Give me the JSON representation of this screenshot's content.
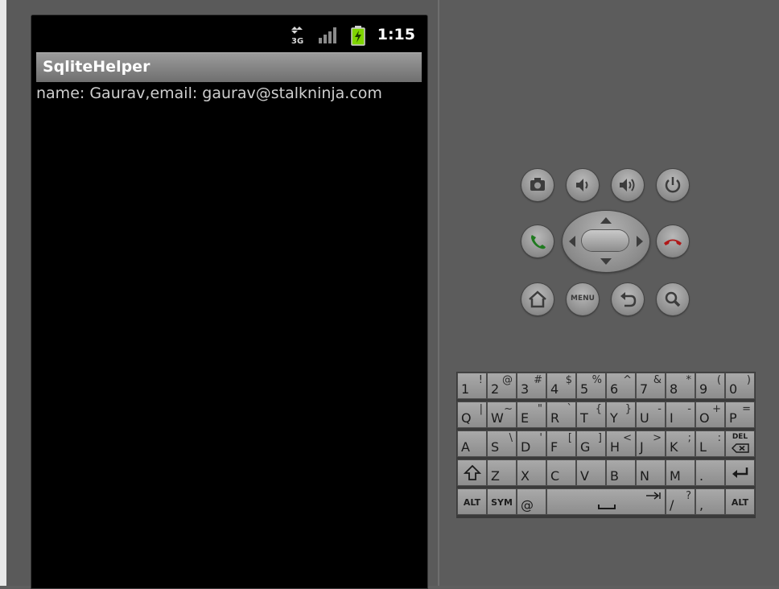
{
  "status_bar": {
    "time": "1:15",
    "network_type": "3G"
  },
  "app": {
    "title": "SqliteHelper",
    "content_text": "name: Gaurav,email: gaurav@stalkninja.com"
  },
  "hardware_buttons": {
    "row1": [
      "camera-icon",
      "volume-down-icon",
      "volume-up-icon",
      "power-icon"
    ],
    "row2": [
      "call-icon",
      "dpad",
      "end-call-icon"
    ],
    "row3": [
      "home-icon",
      "menu-button",
      "back-icon",
      "search-icon"
    ],
    "menu_label": "MENU"
  },
  "keyboard": {
    "row1": [
      {
        "m": "1",
        "a": "!"
      },
      {
        "m": "2",
        "a": "@"
      },
      {
        "m": "3",
        "a": "#"
      },
      {
        "m": "4",
        "a": "$"
      },
      {
        "m": "5",
        "a": "%"
      },
      {
        "m": "6",
        "a": "^"
      },
      {
        "m": "7",
        "a": "&"
      },
      {
        "m": "8",
        "a": "*"
      },
      {
        "m": "9",
        "a": "("
      },
      {
        "m": "0",
        "a": ")"
      }
    ],
    "row2": [
      {
        "m": "Q",
        "a": "|"
      },
      {
        "m": "W",
        "a": "~"
      },
      {
        "m": "E",
        "a": "\""
      },
      {
        "m": "R",
        "a": "`"
      },
      {
        "m": "T",
        "a": "{"
      },
      {
        "m": "Y",
        "a": "}"
      },
      {
        "m": "U",
        "a": "-"
      },
      {
        "m": "I",
        "a": "-"
      },
      {
        "m": "O",
        "a": "+"
      },
      {
        "m": "P",
        "a": "="
      }
    ],
    "row3": [
      {
        "m": "A",
        "a": ""
      },
      {
        "m": "S",
        "a": "\\"
      },
      {
        "m": "D",
        "a": "'"
      },
      {
        "m": "F",
        "a": "["
      },
      {
        "m": "G",
        "a": "]"
      },
      {
        "m": "H",
        "a": "<"
      },
      {
        "m": "J",
        "a": ">"
      },
      {
        "m": "K",
        "a": ";"
      },
      {
        "m": "L",
        "a": ":"
      }
    ],
    "del_label": "DEL",
    "row4": [
      "Z",
      "X",
      "C",
      "V",
      "B",
      "N",
      "M",
      "."
    ],
    "alt_label": "ALT",
    "sym_label": "SYM",
    "at_label": "@",
    "slash_main": "/",
    "slash_alt": "?",
    "comma_label": ","
  },
  "colors": {
    "call_green": "#1f7a1f",
    "end_red": "#b01818",
    "battery_green": "#7fd400"
  }
}
